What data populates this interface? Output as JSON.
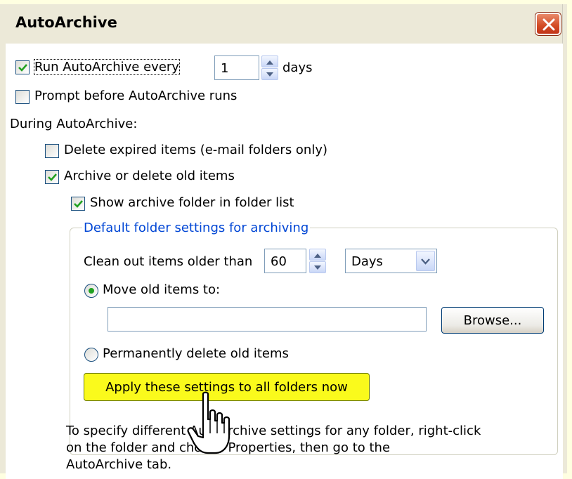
{
  "dialog": {
    "title": "AutoArchive",
    "run_every_label": "Run AutoArchive every",
    "run_every_checked": true,
    "run_every_value": "1",
    "days_label": "days",
    "prompt_label": "Prompt before AutoArchive runs",
    "prompt_checked": false,
    "during_label": "During AutoArchive:",
    "delete_expired_label": "Delete expired items (e-mail folders only)",
    "delete_expired_checked": false,
    "archive_old_label": "Archive or delete old items",
    "archive_old_checked": true,
    "show_folder_label": "Show archive folder in folder list",
    "show_folder_checked": true
  },
  "group": {
    "title": "Default folder settings for archiving",
    "clean_out_label": "Clean out items older than",
    "clean_out_value": "60",
    "unit_selected": "Days",
    "move_label": "Move old items to:",
    "move_selected": true,
    "move_path": "",
    "browse_label": "Browse...",
    "delete_label": "Permanently delete old items",
    "delete_selected": false,
    "apply_label": "Apply these settings to all folders now"
  },
  "hint": {
    "line1": "To specify different AutoArchive settings for any folder, right-click",
    "line2": "on the folder and choose Properties, then go to the",
    "line3": "AutoArchive tab."
  },
  "colors": {
    "highlight_bg": "#ffffe1",
    "group_title": "#0046d5",
    "apply_button": "#fafa1c",
    "check_green": "#21a121"
  },
  "icons": [
    "close-icon",
    "check-icon",
    "spin-up-icon",
    "spin-down-icon",
    "dropdown-arrow-icon",
    "hand-cursor-icon"
  ]
}
